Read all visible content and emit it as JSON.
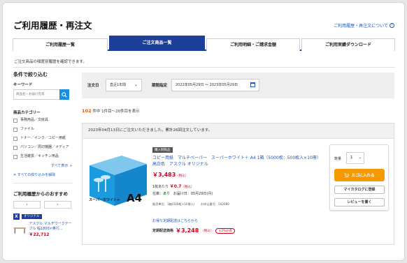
{
  "page": {
    "title": "ご利用履歴・再注文",
    "help_link": "ご利用履歴・再注文について"
  },
  "tabs": [
    {
      "label": "ご利用履歴一覧",
      "active": false
    },
    {
      "label": "ご注文商品一覧",
      "active": true
    },
    {
      "label": "ご利用明細・ご請求金額",
      "active": false
    },
    {
      "label": "ご利用実績ダウンロード",
      "active": false
    }
  ],
  "intro": "ご注文商品の頻度別履歴を確認できます。",
  "sidebar": {
    "filter_title": "条件で絞り込む",
    "keyword_label": "キーワード",
    "keyword_placeholder": "商品名・お届け先等",
    "category_label": "商品カテゴリー",
    "categories": [
      "事務用品／文房具",
      "ファイル",
      "トナー／インク／コピー用紙",
      "パソコン／周辺機器／メディア",
      "生活雑貨／キッチン用品"
    ],
    "show_all": "すべて表示 ＋",
    "clear_all": "すべての絞り込みを解除",
    "reco_title": "ご利用履歴からのおすすめ",
    "pager_prev": "‹",
    "pager_next": "›",
    "reco_badge": "オリジナル",
    "reco_name": "アスクル マルチワークテーブル 幅1800×奥行...",
    "reco_price": "￥22,712"
  },
  "filter": {
    "order_date_label": "注文日",
    "order_date_value": "直近1年間",
    "period_label": "期間指定",
    "period_value": "2022年05月29日 ～ 2023年05月29日"
  },
  "results": {
    "count": "102",
    "text": "件中 1件目～20件目を表示"
  },
  "order": {
    "header": "2023年04月13日にご注文いただきました。累計26回注文しています。",
    "badge": "購入制限品",
    "name": "コピー用紙　マルチペーパー　スーパーホワイト＋ A4 1箱（5000枚：500枚入×10冊） 高白色　アスクル オリジナル",
    "price": "￥3,483",
    "tax": "（税込）",
    "unit_label": "1枚あたり",
    "unit_price": "￥0.7",
    "stock_label": "在庫：",
    "stock_value": "あり",
    "delivery": "お届け日：05月29日(月)",
    "meta": "販売単位：1箱(500枚×10冊入)　　お申込番号：542680",
    "image_label": "スーパーホワイト+",
    "image_size": "A4",
    "sub_link": "お得な定期配送はこちらから",
    "sub_label": "定期配送価格",
    "sub_price": "￥3,248",
    "sub_off": "￥2%お得",
    "qty_label": "数量",
    "qty_value": "1",
    "cart_button": "カゴに入れる",
    "mycatalog_button": "マイカタログに登録",
    "review_button": "レビューを書く"
  },
  "colors": {
    "brand_blue": "#1d3f9a",
    "link_blue": "#1d56b8",
    "price_red": "#d3001c",
    "cart_orange": "#f79a00"
  }
}
